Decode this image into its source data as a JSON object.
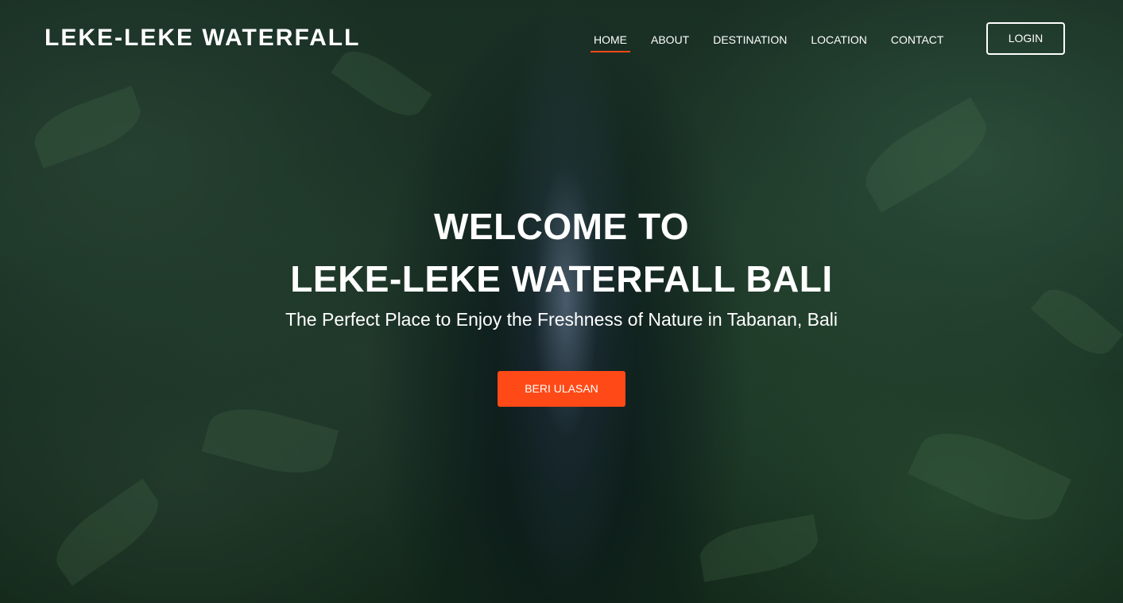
{
  "brand": {
    "name": "LEKE-LEKE WATERFALL"
  },
  "nav": {
    "items": [
      {
        "label": "HOME",
        "active": true
      },
      {
        "label": "ABOUT",
        "active": false
      },
      {
        "label": "DESTINATION",
        "active": false
      },
      {
        "label": "LOCATION",
        "active": false
      },
      {
        "label": "CONTACT",
        "active": false
      }
    ],
    "login_label": "LOGIN"
  },
  "hero": {
    "title_line1": "WELCOME TO",
    "title_line2": "LEKE-LEKE WATERFALL BALI",
    "subtitle": "The Perfect Place to Enjoy the Freshness of Nature in Tabanan, Bali",
    "cta_label": "BERI ULASAN"
  },
  "colors": {
    "accent": "#ff4a17",
    "text": "#ffffff"
  }
}
